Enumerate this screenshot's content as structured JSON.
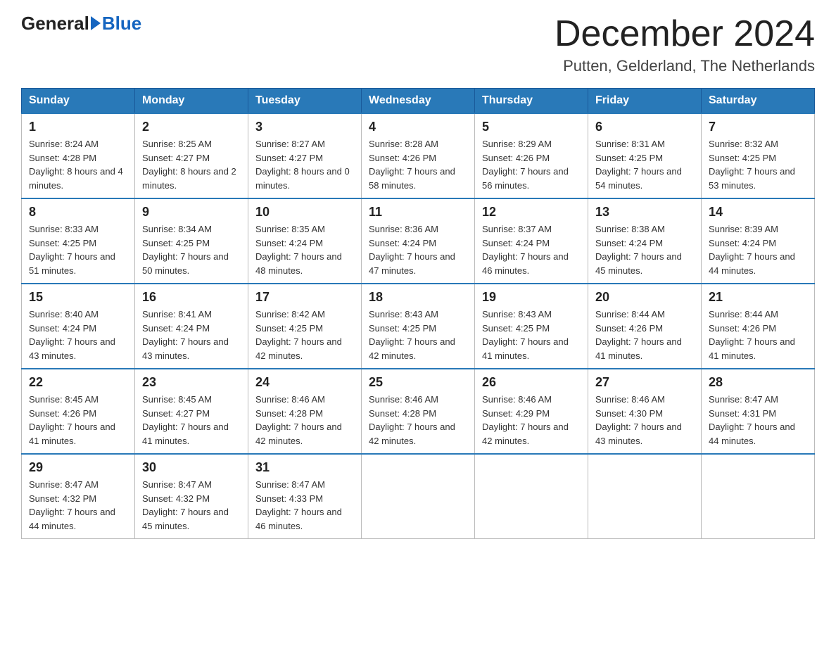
{
  "header": {
    "logo_general": "General",
    "logo_blue": "Blue",
    "month_title": "December 2024",
    "location": "Putten, Gelderland, The Netherlands"
  },
  "weekdays": [
    "Sunday",
    "Monday",
    "Tuesday",
    "Wednesday",
    "Thursday",
    "Friday",
    "Saturday"
  ],
  "weeks": [
    [
      {
        "day": "1",
        "sunrise": "8:24 AM",
        "sunset": "4:28 PM",
        "daylight": "8 hours and 4 minutes."
      },
      {
        "day": "2",
        "sunrise": "8:25 AM",
        "sunset": "4:27 PM",
        "daylight": "8 hours and 2 minutes."
      },
      {
        "day": "3",
        "sunrise": "8:27 AM",
        "sunset": "4:27 PM",
        "daylight": "8 hours and 0 minutes."
      },
      {
        "day": "4",
        "sunrise": "8:28 AM",
        "sunset": "4:26 PM",
        "daylight": "7 hours and 58 minutes."
      },
      {
        "day": "5",
        "sunrise": "8:29 AM",
        "sunset": "4:26 PM",
        "daylight": "7 hours and 56 minutes."
      },
      {
        "day": "6",
        "sunrise": "8:31 AM",
        "sunset": "4:25 PM",
        "daylight": "7 hours and 54 minutes."
      },
      {
        "day": "7",
        "sunrise": "8:32 AM",
        "sunset": "4:25 PM",
        "daylight": "7 hours and 53 minutes."
      }
    ],
    [
      {
        "day": "8",
        "sunrise": "8:33 AM",
        "sunset": "4:25 PM",
        "daylight": "7 hours and 51 minutes."
      },
      {
        "day": "9",
        "sunrise": "8:34 AM",
        "sunset": "4:25 PM",
        "daylight": "7 hours and 50 minutes."
      },
      {
        "day": "10",
        "sunrise": "8:35 AM",
        "sunset": "4:24 PM",
        "daylight": "7 hours and 48 minutes."
      },
      {
        "day": "11",
        "sunrise": "8:36 AM",
        "sunset": "4:24 PM",
        "daylight": "7 hours and 47 minutes."
      },
      {
        "day": "12",
        "sunrise": "8:37 AM",
        "sunset": "4:24 PM",
        "daylight": "7 hours and 46 minutes."
      },
      {
        "day": "13",
        "sunrise": "8:38 AM",
        "sunset": "4:24 PM",
        "daylight": "7 hours and 45 minutes."
      },
      {
        "day": "14",
        "sunrise": "8:39 AM",
        "sunset": "4:24 PM",
        "daylight": "7 hours and 44 minutes."
      }
    ],
    [
      {
        "day": "15",
        "sunrise": "8:40 AM",
        "sunset": "4:24 PM",
        "daylight": "7 hours and 43 minutes."
      },
      {
        "day": "16",
        "sunrise": "8:41 AM",
        "sunset": "4:24 PM",
        "daylight": "7 hours and 43 minutes."
      },
      {
        "day": "17",
        "sunrise": "8:42 AM",
        "sunset": "4:25 PM",
        "daylight": "7 hours and 42 minutes."
      },
      {
        "day": "18",
        "sunrise": "8:43 AM",
        "sunset": "4:25 PM",
        "daylight": "7 hours and 42 minutes."
      },
      {
        "day": "19",
        "sunrise": "8:43 AM",
        "sunset": "4:25 PM",
        "daylight": "7 hours and 41 minutes."
      },
      {
        "day": "20",
        "sunrise": "8:44 AM",
        "sunset": "4:26 PM",
        "daylight": "7 hours and 41 minutes."
      },
      {
        "day": "21",
        "sunrise": "8:44 AM",
        "sunset": "4:26 PM",
        "daylight": "7 hours and 41 minutes."
      }
    ],
    [
      {
        "day": "22",
        "sunrise": "8:45 AM",
        "sunset": "4:26 PM",
        "daylight": "7 hours and 41 minutes."
      },
      {
        "day": "23",
        "sunrise": "8:45 AM",
        "sunset": "4:27 PM",
        "daylight": "7 hours and 41 minutes."
      },
      {
        "day": "24",
        "sunrise": "8:46 AM",
        "sunset": "4:28 PM",
        "daylight": "7 hours and 42 minutes."
      },
      {
        "day": "25",
        "sunrise": "8:46 AM",
        "sunset": "4:28 PM",
        "daylight": "7 hours and 42 minutes."
      },
      {
        "day": "26",
        "sunrise": "8:46 AM",
        "sunset": "4:29 PM",
        "daylight": "7 hours and 42 minutes."
      },
      {
        "day": "27",
        "sunrise": "8:46 AM",
        "sunset": "4:30 PM",
        "daylight": "7 hours and 43 minutes."
      },
      {
        "day": "28",
        "sunrise": "8:47 AM",
        "sunset": "4:31 PM",
        "daylight": "7 hours and 44 minutes."
      }
    ],
    [
      {
        "day": "29",
        "sunrise": "8:47 AM",
        "sunset": "4:32 PM",
        "daylight": "7 hours and 44 minutes."
      },
      {
        "day": "30",
        "sunrise": "8:47 AM",
        "sunset": "4:32 PM",
        "daylight": "7 hours and 45 minutes."
      },
      {
        "day": "31",
        "sunrise": "8:47 AM",
        "sunset": "4:33 PM",
        "daylight": "7 hours and 46 minutes."
      },
      null,
      null,
      null,
      null
    ]
  ],
  "labels": {
    "sunrise_prefix": "Sunrise: ",
    "sunset_prefix": "Sunset: ",
    "daylight_prefix": "Daylight: "
  }
}
